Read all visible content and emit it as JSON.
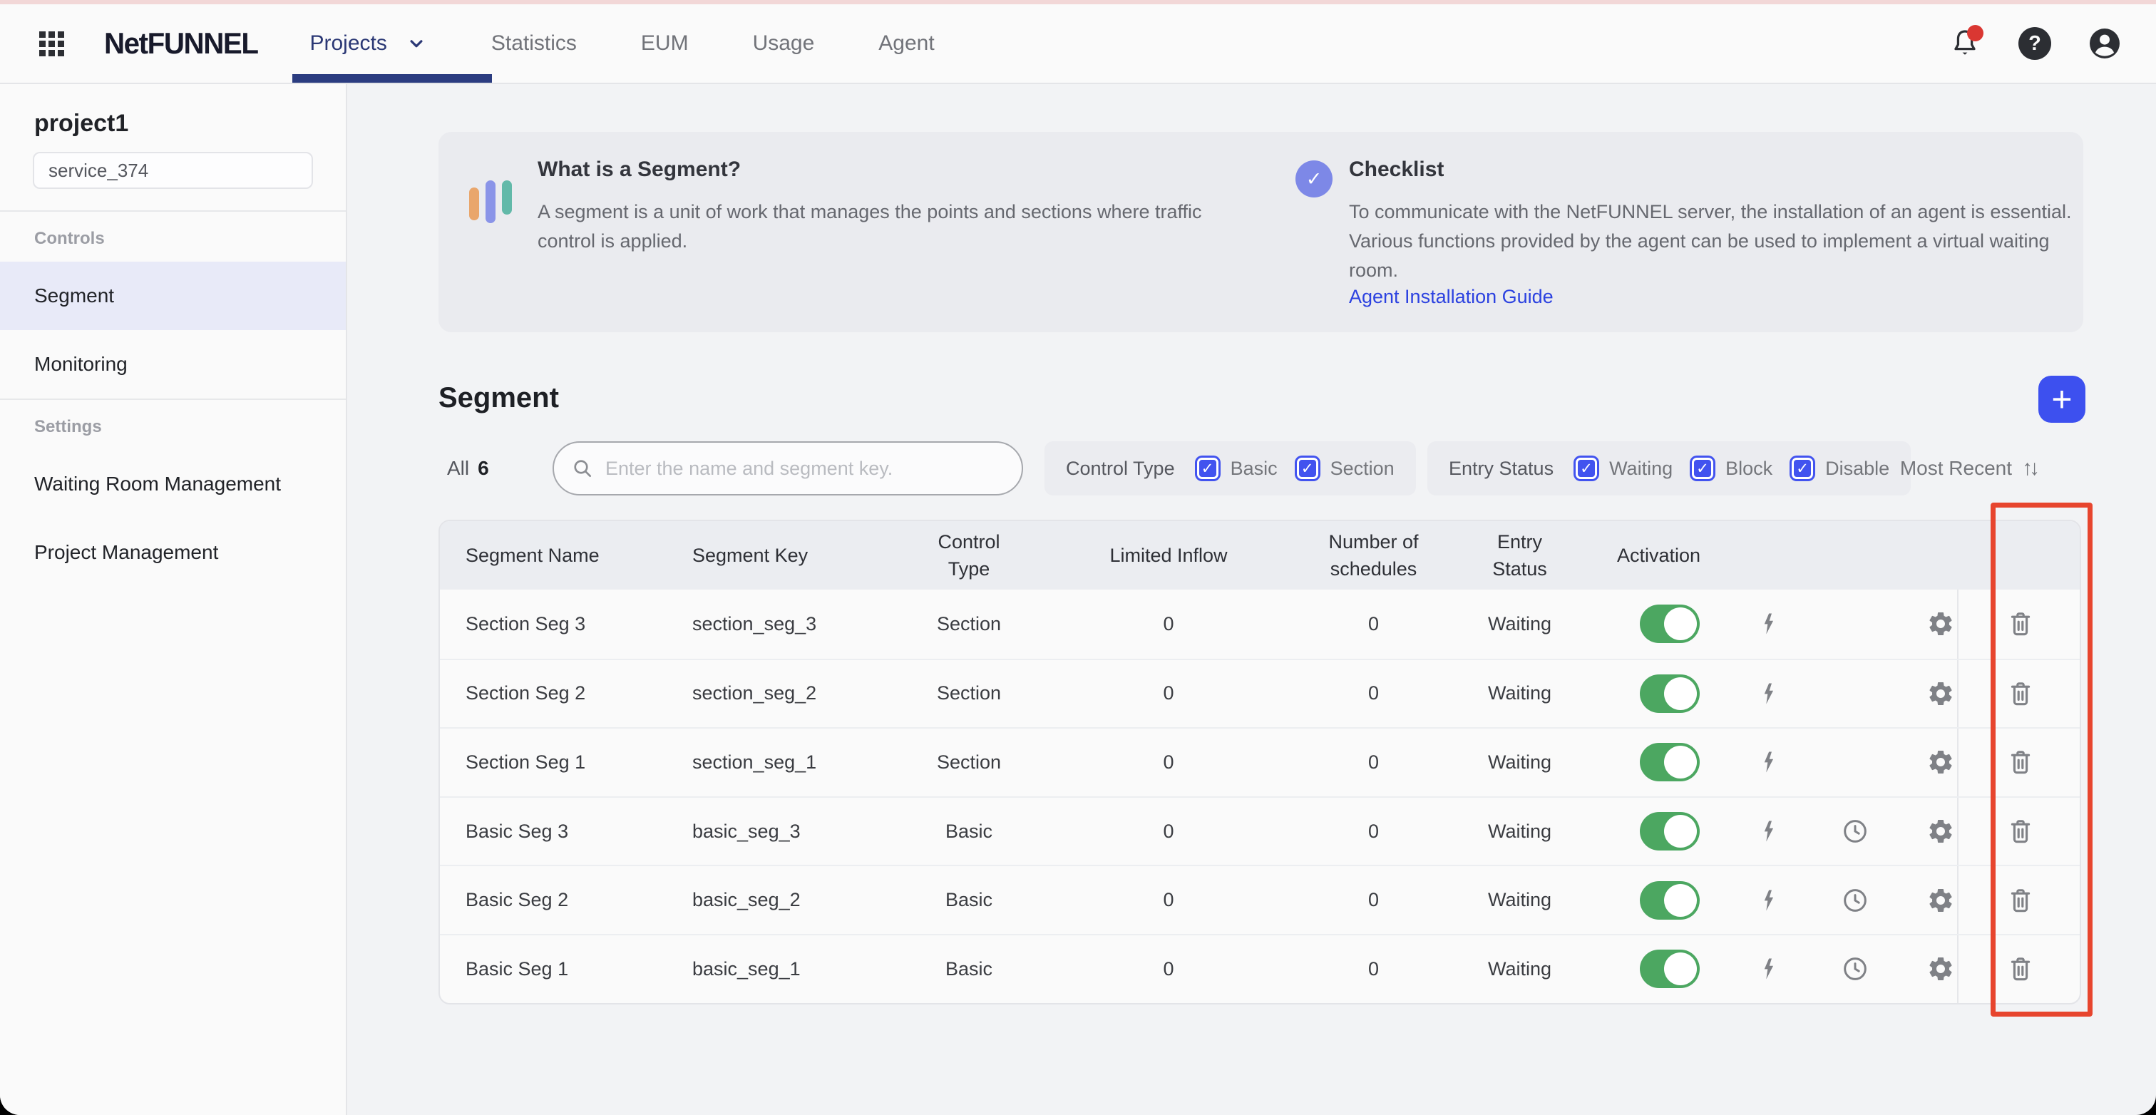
{
  "colors": {
    "accent_blue": "#3d50ef",
    "checkbox_blue": "#4253ef",
    "toggle_green": "#4ca761",
    "annotation_red": "#e7452e",
    "link_blue": "#2c42e0",
    "active_nav": "#2b3c80"
  },
  "header": {
    "logo": "NetFUNNEL",
    "nav": [
      {
        "label": "Projects",
        "active": true
      },
      {
        "label": "Statistics",
        "active": false
      },
      {
        "label": "EUM",
        "active": false
      },
      {
        "label": "Usage",
        "active": false
      },
      {
        "label": "Agent",
        "active": false
      }
    ]
  },
  "sidebar": {
    "project_name": "project1",
    "service_value": "service_374",
    "sections": [
      {
        "label": "Controls",
        "items": [
          {
            "label": "Segment",
            "active": true
          },
          {
            "label": "Monitoring",
            "active": false
          }
        ]
      },
      {
        "label": "Settings",
        "items": [
          {
            "label": "Waiting Room Management",
            "active": false
          },
          {
            "label": "Project Management",
            "active": false
          }
        ]
      }
    ]
  },
  "banner": {
    "what": {
      "title": "What is a Segment?",
      "body": "A segment is a unit of work that manages the points and sections where traffic control is applied."
    },
    "checklist": {
      "title": "Checklist",
      "body": "To communicate with the NetFUNNEL server, the installation of an agent is essential. Various functions provided by the agent can be used to implement a virtual waiting room.",
      "link": "Agent Installation Guide"
    }
  },
  "content": {
    "title": "Segment",
    "all_label": "All",
    "all_count": "6",
    "search_placeholder": "Enter the name and segment key.",
    "filters": [
      {
        "label": "Control Type",
        "options": [
          {
            "label": "Basic",
            "checked": true
          },
          {
            "label": "Section",
            "checked": true
          }
        ]
      },
      {
        "label": "Entry Status",
        "options": [
          {
            "label": "Waiting",
            "checked": true
          },
          {
            "label": "Block",
            "checked": true
          },
          {
            "label": "Disable",
            "checked": true
          }
        ]
      }
    ],
    "sort_label": "Most Recent"
  },
  "table": {
    "columns": [
      "Segment Name",
      "Segment Key",
      "Control Type",
      "Limited Inflow",
      "Number of schedules",
      "Entry Status",
      "Activation",
      ""
    ],
    "rows": [
      {
        "name": "Section Seg 3",
        "key": "section_seg_3",
        "control_type": "Section",
        "limited_inflow": "0",
        "schedules": "0",
        "entry_status": "Waiting",
        "active": true,
        "has_schedule": false
      },
      {
        "name": "Section Seg 2",
        "key": "section_seg_2",
        "control_type": "Section",
        "limited_inflow": "0",
        "schedules": "0",
        "entry_status": "Waiting",
        "active": true,
        "has_schedule": false
      },
      {
        "name": "Section Seg 1",
        "key": "section_seg_1",
        "control_type": "Section",
        "limited_inflow": "0",
        "schedules": "0",
        "entry_status": "Waiting",
        "active": true,
        "has_schedule": false
      },
      {
        "name": "Basic Seg 3",
        "key": "basic_seg_3",
        "control_type": "Basic",
        "limited_inflow": "0",
        "schedules": "0",
        "entry_status": "Waiting",
        "active": true,
        "has_schedule": true
      },
      {
        "name": "Basic Seg 2",
        "key": "basic_seg_2",
        "control_type": "Basic",
        "limited_inflow": "0",
        "schedules": "0",
        "entry_status": "Waiting",
        "active": true,
        "has_schedule": true
      },
      {
        "name": "Basic Seg 1",
        "key": "basic_seg_1",
        "control_type": "Basic",
        "limited_inflow": "0",
        "schedules": "0",
        "entry_status": "Waiting",
        "active": true,
        "has_schedule": true
      }
    ]
  }
}
